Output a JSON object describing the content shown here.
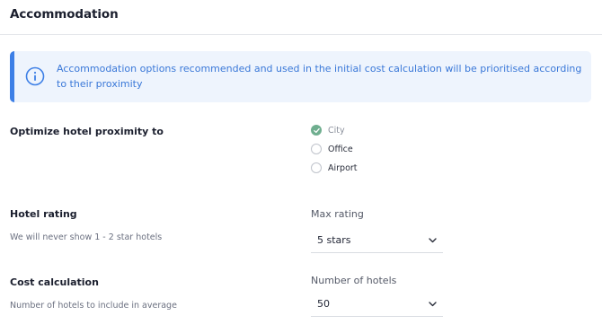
{
  "header": {
    "title": "Accommodation"
  },
  "info": {
    "icon": "info-icon",
    "text": "Accommodation options recommended and used in the initial cost calculation will be prioritised according to their proximity",
    "accent": "#3d7fe6"
  },
  "proximity": {
    "label": "Optimize hotel proximity to",
    "options": [
      {
        "label": "City",
        "checked": true
      },
      {
        "label": "Office",
        "checked": false
      },
      {
        "label": "Airport",
        "checked": false
      }
    ]
  },
  "rating": {
    "label": "Hotel rating",
    "sub": "We will never show 1 - 2 star hotels",
    "field_label": "Max rating",
    "value": "5 stars"
  },
  "cost": {
    "label": "Cost calculation",
    "sub": "Number of hotels to include in average",
    "field_label": "Number of hotels",
    "value": "50"
  }
}
